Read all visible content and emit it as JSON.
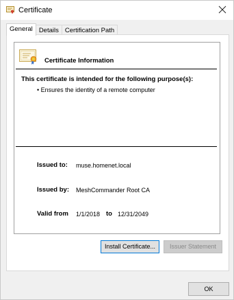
{
  "window": {
    "title": "Certificate"
  },
  "tabs": [
    {
      "label": "General",
      "active": true
    },
    {
      "label": "Details",
      "active": false
    },
    {
      "label": "Certification Path",
      "active": false
    }
  ],
  "info": {
    "heading": "Certificate Information",
    "purpose_heading": "This certificate is intended for the following purpose(s):",
    "purposes": [
      "Ensures the identity of a remote computer"
    ],
    "issued_to_label": "Issued to:",
    "issued_to_value": "muse.homenet.local",
    "issued_by_label": "Issued by:",
    "issued_by_value": "MeshCommander Root CA",
    "valid_from_label": "Valid from",
    "valid_from_value": "1/1/2018",
    "valid_to_label": "to",
    "valid_to_value": "12/31/2049"
  },
  "buttons": {
    "install": "Install Certificate...",
    "issuer_statement": "Issuer Statement",
    "ok": "OK"
  },
  "colors": {
    "focus_border": "#0078d7",
    "dialog_bg": "#f0f0f0",
    "panel_bg": "#ffffff"
  }
}
